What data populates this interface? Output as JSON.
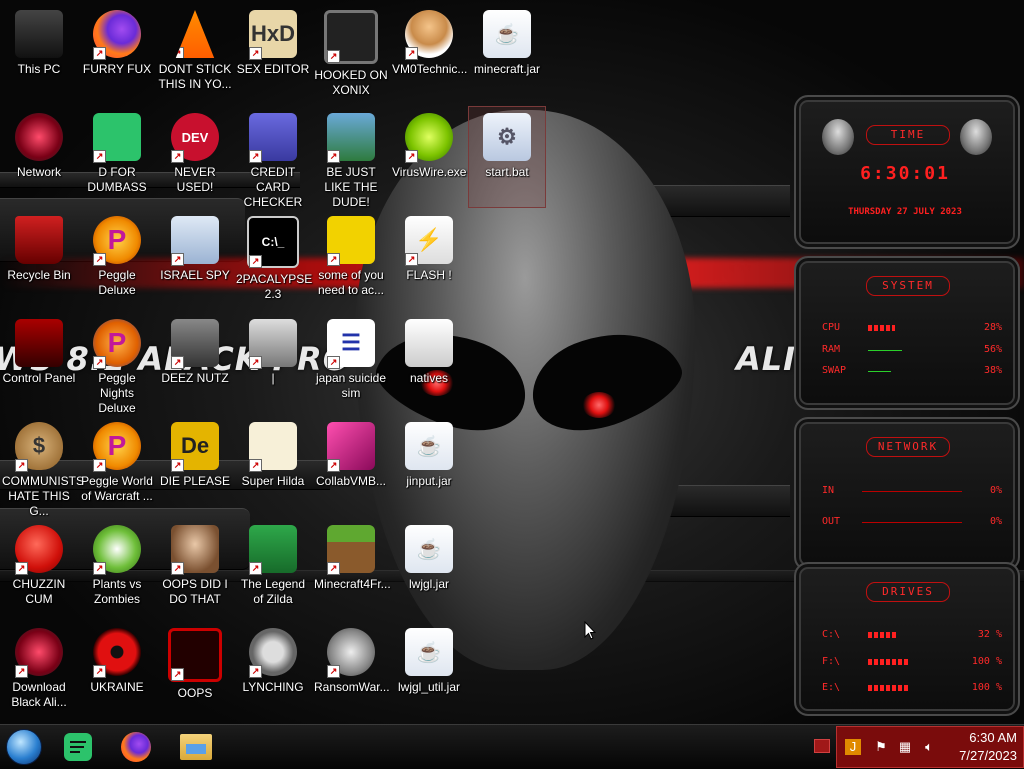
{
  "wallpaper": {
    "left_text": "WS 8.1 ALACK PRO",
    "right_text": "ALIENWARE 2"
  },
  "icons": [
    {
      "label": "This PC",
      "icon": "computer-icon"
    },
    {
      "label": "FURRY FUX",
      "icon": "firefox-icon"
    },
    {
      "label": "DONT STICK THIS IN YO...",
      "icon": "vlc-cone-icon"
    },
    {
      "label": "SEX EDITOR",
      "icon": "hxd-editor-icon"
    },
    {
      "label": "HOOKED ON XONIX",
      "icon": "xonix-icon"
    },
    {
      "label": "VM0Technic...",
      "icon": "doctor-icon"
    },
    {
      "label": "minecraft.jar",
      "icon": "java-jar-icon"
    },
    {
      "label": "Network",
      "icon": "network-orb-icon"
    },
    {
      "label": "D FOR DUMBASS",
      "icon": "spotify-icon"
    },
    {
      "label": "NEVER USED!",
      "icon": "devcpp-icon"
    },
    {
      "label": "CREDIT CARD CHECKER",
      "icon": "credit-card-icon"
    },
    {
      "label": "BE JUST LIKE THE DUDE!",
      "icon": "elf-icon"
    },
    {
      "label": "VirusWire.exe",
      "icon": "lime-icon"
    },
    {
      "label": "start.bat",
      "icon": "batch-gear-icon"
    },
    {
      "label": "Recycle Bin",
      "icon": "recycle-bin-icon"
    },
    {
      "label": "Peggle Deluxe",
      "icon": "peggle-icon"
    },
    {
      "label": "ISRAEL SPY",
      "icon": "spy-network-icon"
    },
    {
      "label": "2PACALYPSE 2.3",
      "icon": "terminal-icon"
    },
    {
      "label": "some of you need to ac...",
      "icon": "beaver-icon"
    },
    {
      "label": "FLASH !",
      "icon": "flash-icon"
    },
    {
      "label": "Control Panel",
      "icon": "control-panel-icon"
    },
    {
      "label": "Peggle Nights Deluxe",
      "icon": "peggle-nights-icon"
    },
    {
      "label": "DEEZ NUTZ",
      "icon": "windows-stack-icon"
    },
    {
      "label": "|",
      "icon": "file-icon"
    },
    {
      "label": "japan suicide sim",
      "icon": "document-icon"
    },
    {
      "label": "natives",
      "icon": "folder-file-icon"
    },
    {
      "label": "COMMUNISTS HATE THIS G...",
      "icon": "money-bag-icon"
    },
    {
      "label": "Peggle World of Warcraft ...",
      "icon": "peggle-wow-icon"
    },
    {
      "label": "DIE PLEASE",
      "icon": "dreamweaver-icon"
    },
    {
      "label": "Super Hilda",
      "icon": "pixel-character-icon"
    },
    {
      "label": "CollabVMB...",
      "icon": "vm-icon"
    },
    {
      "label": "jinput.jar",
      "icon": "java-jar-icon"
    },
    {
      "label": "CHUZZIN CUM",
      "icon": "chuzzle-icon"
    },
    {
      "label": "Plants vs Zombies",
      "icon": "plant-icon"
    },
    {
      "label": "OOPS DID I DO THAT",
      "icon": "portrait-icon"
    },
    {
      "label": "The Legend of Zilda",
      "icon": "zelda-icon"
    },
    {
      "label": "Minecraft4Fr...",
      "icon": "minecraft-grass-icon"
    },
    {
      "label": "lwjgl.jar",
      "icon": "java-jar-icon"
    },
    {
      "label": "Download Black Ali...",
      "icon": "alien-orb-icon"
    },
    {
      "label": "UKRAINE",
      "icon": "radiation-icon"
    },
    {
      "label": "OOPS",
      "icon": "red-screen-icon"
    },
    {
      "label": "LYNCHING",
      "icon": "noose-icon"
    },
    {
      "label": "RansomWar...",
      "icon": "skull-icon"
    },
    {
      "label": "lwjgl_util.jar",
      "icon": "java-jar-icon"
    }
  ],
  "gadget": {
    "time": {
      "title": "TIME",
      "clock": "6:30:01",
      "date": "THURSDAY 27 JULY 2023"
    },
    "system": {
      "title": "SYSTEM",
      "rows": [
        {
          "name": "CPU",
          "value": "28%",
          "level": 0.28
        },
        {
          "name": "RAM",
          "value": "56%",
          "level": 0.56
        },
        {
          "name": "SWAP",
          "value": "38%",
          "level": 0.38
        }
      ]
    },
    "network": {
      "title": "NETWORK",
      "rows": [
        {
          "name": "IN",
          "value": "0%"
        },
        {
          "name": "OUT",
          "value": "0%"
        }
      ]
    },
    "drives": {
      "title": "DRIVES",
      "rows": [
        {
          "name": "C:\\",
          "value": "32 %",
          "level": 0.32
        },
        {
          "name": "F:\\",
          "value": "100 %",
          "level": 1.0
        },
        {
          "name": "E:\\",
          "value": "100 %",
          "level": 1.0
        }
      ]
    }
  },
  "taskbar": {
    "pinned": [
      {
        "icon": "start-orb-icon"
      },
      {
        "icon": "spotify-icon"
      },
      {
        "icon": "firefox-icon"
      },
      {
        "icon": "file-explorer-icon"
      }
    ],
    "tray": {
      "time": "6:30 AM",
      "date": "7/27/2023",
      "icons": [
        "show-hidden-icon",
        "java-update-icon",
        "action-center-flag-icon",
        "network-icon",
        "volume-icon"
      ]
    }
  },
  "colors": {
    "accent_red": "#ff2020",
    "tray_bg": "#7a0c0c"
  }
}
